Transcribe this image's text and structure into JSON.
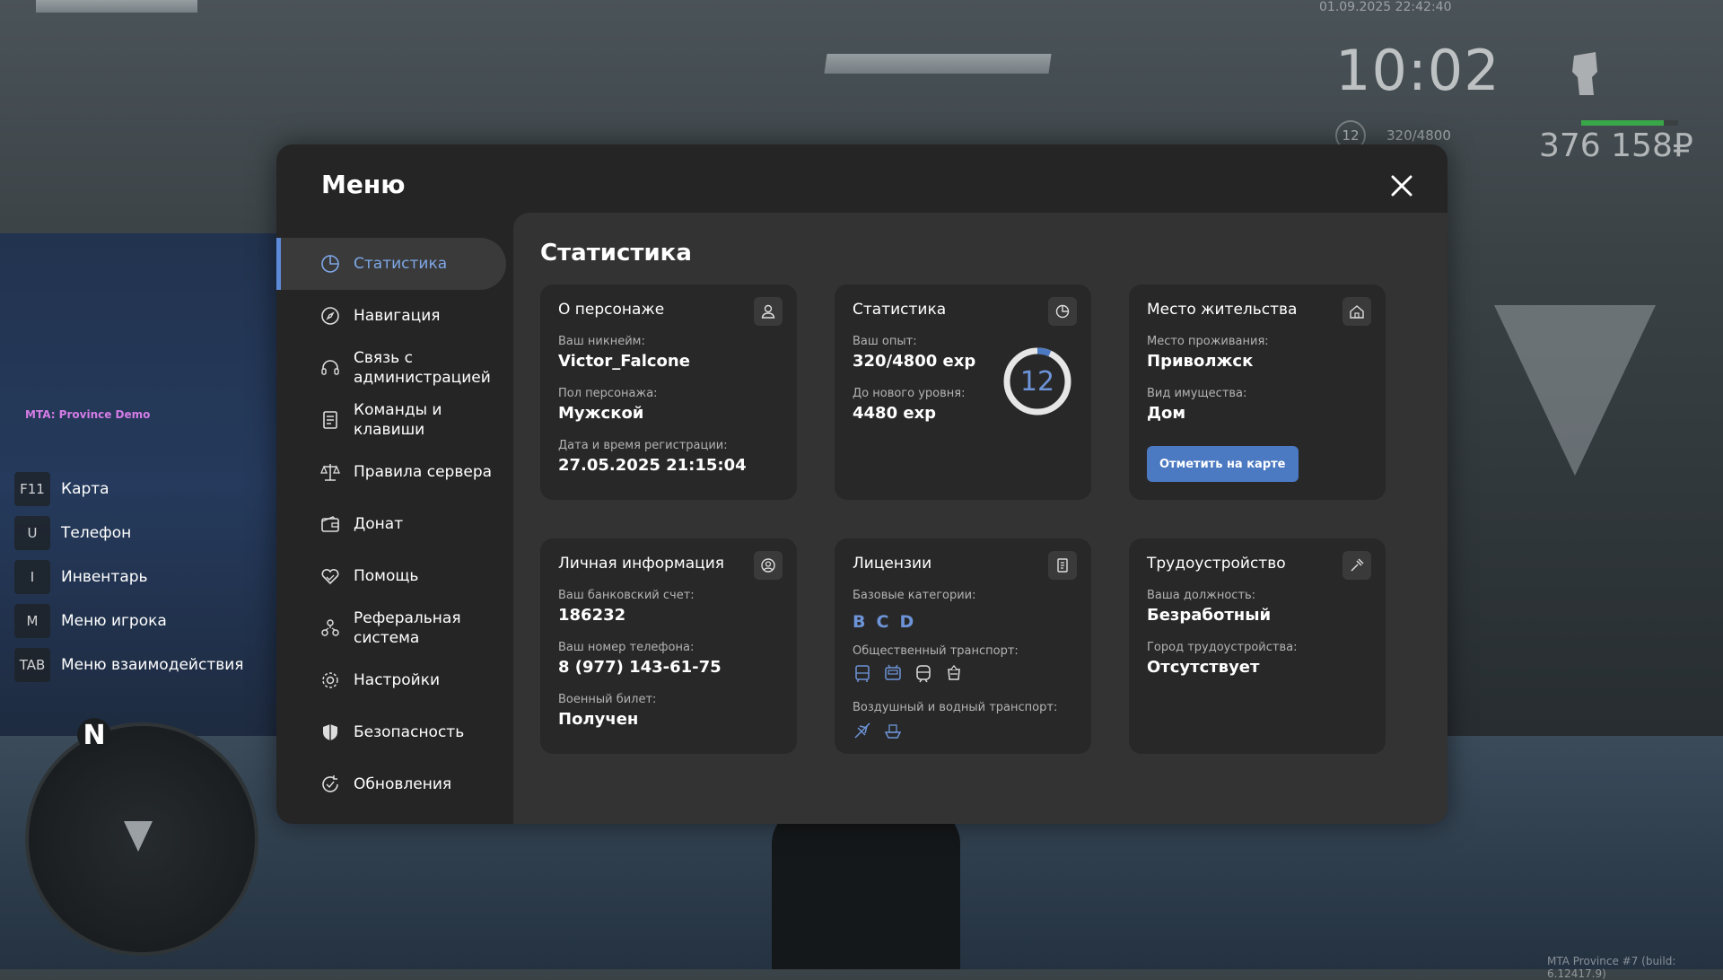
{
  "hud": {
    "datetime": "01.09.2025 22:42:40",
    "time": "10:02",
    "level": "12",
    "exp": "320/4800",
    "money": "376 158₽",
    "health_fraction": 0.85
  },
  "server_label": "MTA: Province Demo",
  "hotkeys": [
    {
      "key": "F11",
      "label": "Карта"
    },
    {
      "key": "U",
      "label": "Телефон"
    },
    {
      "key": "I",
      "label": "Инвентарь"
    },
    {
      "key": "M",
      "label": "Меню игрока"
    },
    {
      "key": "TAB",
      "label": "Меню взаимодействия"
    }
  ],
  "minimap": {
    "north": "N"
  },
  "build": "MTA Province #7 (build: 6.12417.9)",
  "menu": {
    "title": "Меню",
    "sidebar": [
      {
        "label": "Статистика",
        "icon": "pie-chart-icon",
        "active": true
      },
      {
        "label": "Навигация",
        "icon": "compass-icon"
      },
      {
        "label": "Связь с администрацией",
        "icon": "headset-icon"
      },
      {
        "label": "Команды и клавиши",
        "icon": "document-icon"
      },
      {
        "label": "Правила сервера",
        "icon": "scales-icon"
      },
      {
        "label": "Донат",
        "icon": "wallet-icon"
      },
      {
        "label": "Помощь",
        "icon": "heart-hand-icon"
      },
      {
        "label": "Реферальная система",
        "icon": "people-icon"
      },
      {
        "label": "Настройки",
        "icon": "gear-icon"
      },
      {
        "label": "Безопасность",
        "icon": "shield-icon"
      },
      {
        "label": "Обновления",
        "icon": "refresh-icon"
      }
    ],
    "content_title": "Статистика",
    "character": {
      "title": "О персонаже",
      "nickname_label": "Ваш никнейм:",
      "nickname": "Victor_Falcone",
      "gender_label": "Пол персонажа:",
      "gender": "Мужской",
      "reg_label": "Дата и время регистрации:",
      "reg": "27.05.2025 21:15:04"
    },
    "stats": {
      "title": "Статистика",
      "exp_label": "Ваш опыт:",
      "exp": "320/4800 exp",
      "next_label": "До нового уровня:",
      "next": "4480 exp",
      "level": "12",
      "level_progress": 0.067
    },
    "residence": {
      "title": "Место жительства",
      "place_label": "Место проживания:",
      "place": "Приволжск",
      "property_label": "Вид имущества:",
      "property": "Дом",
      "button": "Отметить на карте"
    },
    "personal": {
      "title": "Личная информация",
      "bank_label": "Ваш банковский счет:",
      "bank": "186232",
      "phone_label": "Ваш номер телефона:",
      "phone": "8 (977) 143-61-75",
      "military_label": "Военный билет:",
      "military": "Получен"
    },
    "licenses": {
      "title": "Лицензии",
      "base_label": "Базовые категории:",
      "categories": [
        "B",
        "C",
        "D"
      ],
      "public_label": "Общественный транспорт:",
      "air_label": "Воздушный и водный транспорт:"
    },
    "employment": {
      "title": "Трудоустройство",
      "position_label": "Ваша должность:",
      "position": "Безработный",
      "city_label": "Город трудоустройства:",
      "city": "Отсутствует"
    }
  }
}
